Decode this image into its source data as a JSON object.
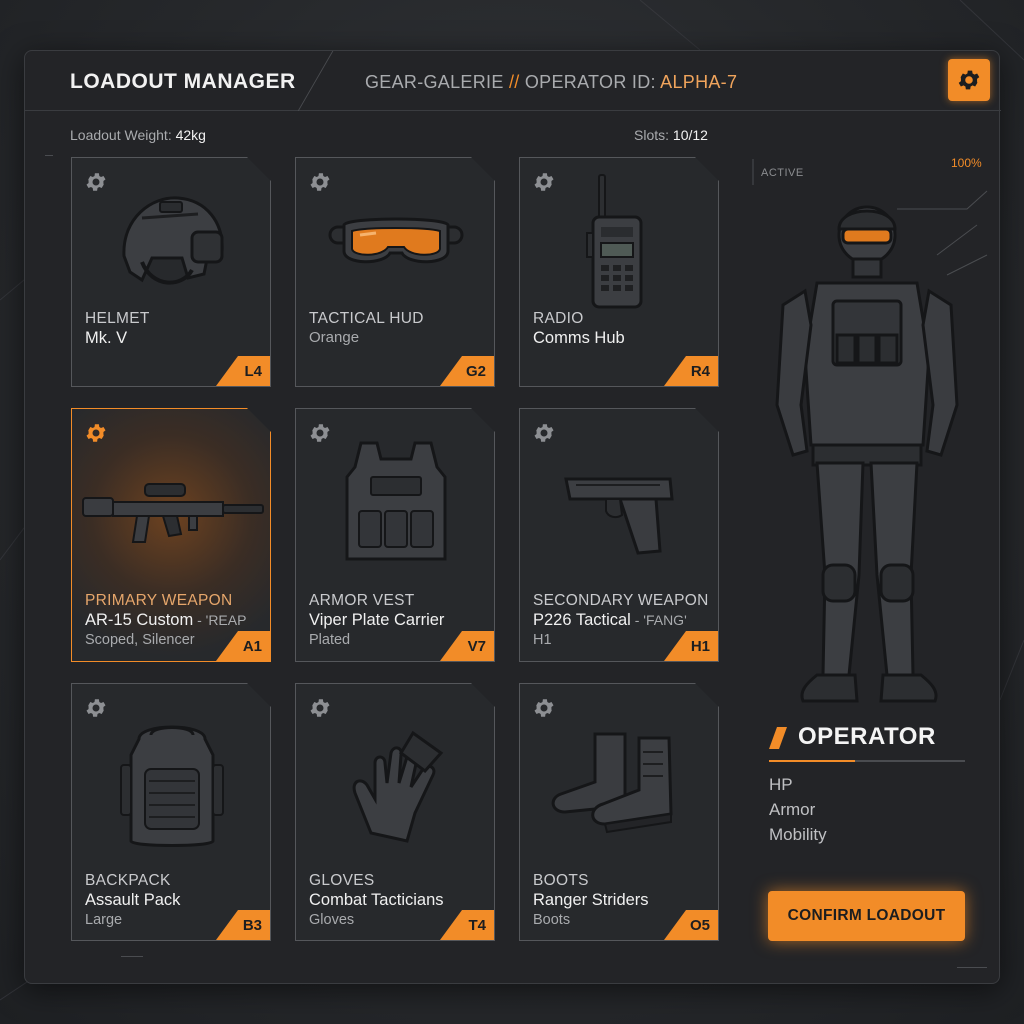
{
  "header": {
    "title": "LOADOUT MANAGER",
    "subtitle_prefix": "GEAR-GALERIE",
    "subtitle_sep": "//",
    "subtitle_label": "OPERATOR ID:",
    "operator_id": "ALPHA-7",
    "settings_icon": "gear-icon"
  },
  "stats": {
    "weight_label": "Loadout Weight:",
    "weight_value": "42kg",
    "slots_label": "Slots:",
    "slots_value": "10/12"
  },
  "slots": [
    {
      "category": "HELMET",
      "name": "Mk. V",
      "alias": "",
      "detail": "",
      "tier": "L4",
      "icon": "helmet-icon",
      "selected": false
    },
    {
      "category": "TACTICAL HUD",
      "name": "Orange",
      "alias": "",
      "detail": "",
      "tier": "G2",
      "icon": "goggles-icon",
      "selected": false
    },
    {
      "category": "RADIO",
      "name": "Comms Hub",
      "alias": "",
      "detail": "",
      "tier": "R4",
      "icon": "radio-icon",
      "selected": false
    },
    {
      "category": "PRIMARY WEAPON",
      "name": "AR-15 Custom",
      "alias": " - 'REAP",
      "detail": "Scoped, Silencer",
      "tier": "A1",
      "icon": "rifle-icon",
      "selected": true
    },
    {
      "category": "ARMOR VEST",
      "name": "Viper Plate Carrier",
      "alias": "",
      "detail": "Plated",
      "tier": "V7",
      "icon": "vest-icon",
      "selected": false
    },
    {
      "category": "SECONDARY WEAPON",
      "name": "P226 Tactical",
      "alias": " - 'FANG'",
      "detail": "H1",
      "tier": "H1",
      "icon": "pistol-icon",
      "selected": false
    },
    {
      "category": "BACKPACK",
      "name": "Assault Pack",
      "alias": "",
      "detail": "Large",
      "tier": "B3",
      "icon": "backpack-icon",
      "selected": false
    },
    {
      "category": "GLOVES",
      "name": "Combat Tacticians",
      "alias": "",
      "detail": "Gloves",
      "tier": "T4",
      "icon": "gloves-icon",
      "selected": false
    },
    {
      "category": "BOOTS",
      "name": "Ranger Striders",
      "alias": "",
      "detail": "Boots",
      "tier": "O5",
      "icon": "boots-icon",
      "selected": false
    }
  ],
  "operator": {
    "status": "ACTIVE",
    "percent": "100%",
    "title": "OPERATOR",
    "stats": [
      "HP",
      "Armor",
      "Mobility"
    ],
    "confirm_label": "CONFIRM LOADOUT"
  },
  "colors": {
    "accent": "#f28c28",
    "panel": "#232427",
    "card": "#27292c"
  }
}
